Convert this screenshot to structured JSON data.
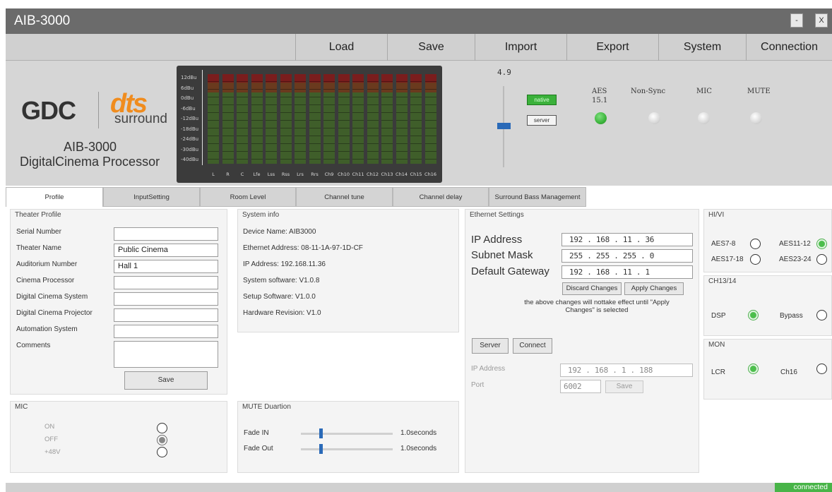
{
  "window": {
    "title": "AIB-3000",
    "minimize_label": "-",
    "close_label": "X"
  },
  "menu": [
    "Load",
    "Save",
    "Import",
    "Export",
    "System",
    "Connection"
  ],
  "header": {
    "logo_gdc": "GDC",
    "logo_dts": "dts",
    "logo_surround": "surround",
    "model": "AIB-3000",
    "product": "DigitalCinema Processor"
  },
  "meter": {
    "db_scale": [
      "12dBu",
      "6dBu",
      "0dBu",
      "-6dBu",
      "-12dBu",
      "-18dBu",
      "-24dBu",
      "-30dBu",
      "-40dBu"
    ],
    "channels": [
      "L",
      "R",
      "C",
      "Lfe",
      "Lss",
      "Rss",
      "Lrs",
      "Rrs",
      "Ch9",
      "Ch10",
      "Ch11",
      "Ch12",
      "Ch13",
      "Ch14",
      "Ch15",
      "Ch16"
    ]
  },
  "volume": {
    "value": "4.9",
    "level": 0.49
  },
  "source_buttons": {
    "native": "native",
    "server": "server"
  },
  "indicators": [
    {
      "label": "AES",
      "sub": "15.1",
      "on": true
    },
    {
      "label": "Non-Sync",
      "sub": "",
      "on": false
    },
    {
      "label": "MIC",
      "sub": "",
      "on": false
    },
    {
      "label": "MUTE",
      "sub": "",
      "on": false
    }
  ],
  "tabs": [
    "Profile",
    "InputSetting",
    "Room Level",
    "Channel tune",
    "Channel delay",
    "Surround Bass Management"
  ],
  "active_tab": "Profile",
  "theater_profile": {
    "title": "Theater Profile",
    "fields": [
      {
        "label": "Serial Number",
        "value": ""
      },
      {
        "label": "Theater Name",
        "value": "Public Cinema"
      },
      {
        "label": "Auditorium Number",
        "value": "Hall 1"
      },
      {
        "label": "Cinema Processor",
        "value": ""
      },
      {
        "label": "Digital Cinema System",
        "value": ""
      },
      {
        "label": "Digital Cinema Projector",
        "value": ""
      },
      {
        "label": "Automation System",
        "value": ""
      },
      {
        "label": "Comments",
        "value": ""
      }
    ],
    "save_label": "Save"
  },
  "system_info": {
    "title": "System info",
    "lines": [
      "Device Name:  AIB3000",
      "Ethernet Address: 08-11-1A-97-1D-CF",
      "IP Address: 192.168.11.36",
      "System software: V1.0.8",
      "Setup Software: V1.0.0",
      "Hardware Revision: V1.0"
    ]
  },
  "ethernet": {
    "title": "Ethernet Settings",
    "ip_label": "IP Address",
    "ip_value": "192 . 168 . 11 . 36",
    "mask_label": "Subnet Mask",
    "mask_value": "255 . 255 . 255 . 0",
    "gateway_label": "Default Gateway",
    "gateway_value": "192 . 168 . 11 . 1",
    "discard_label": "Discard Changes",
    "apply_label": "Apply Changes",
    "note": "the above changes will nottake effect until  \"Apply Changes\" is selected",
    "server_label": "Server",
    "connect_label": "Connect",
    "server_ip_label": "IP Address",
    "server_ip_value": "192 . 168 . 1 . 188",
    "port_label": "Port",
    "port_value": "6002",
    "save_label": "Save"
  },
  "hivi": {
    "title": "HI/VI",
    "options": [
      {
        "label": "AES7-8",
        "selected": false
      },
      {
        "label": "AES11-12",
        "selected": true
      },
      {
        "label": "AES17-18",
        "selected": false
      },
      {
        "label": "AES23-24",
        "selected": false
      }
    ]
  },
  "ch1314": {
    "title": "CH13/14",
    "options": [
      {
        "label": "DSP",
        "selected": true
      },
      {
        "label": "Bypass",
        "selected": false
      }
    ]
  },
  "mon": {
    "title": "MON",
    "options": [
      {
        "label": "LCR",
        "selected": true
      },
      {
        "label": "Ch16",
        "selected": false
      }
    ]
  },
  "mic": {
    "title": "MIC",
    "options": [
      {
        "label": "ON",
        "selected": false
      },
      {
        "label": "OFF",
        "selected": true
      },
      {
        "label": "+48V",
        "selected": false
      }
    ]
  },
  "mute_duration": {
    "title": "MUTE Duartion",
    "fade_in_label": "Fade IN",
    "fade_in_value": "1.0seconds",
    "fade_out_label": "Fade Out",
    "fade_out_value": "1.0seconds"
  },
  "status": {
    "connection": "connected"
  }
}
